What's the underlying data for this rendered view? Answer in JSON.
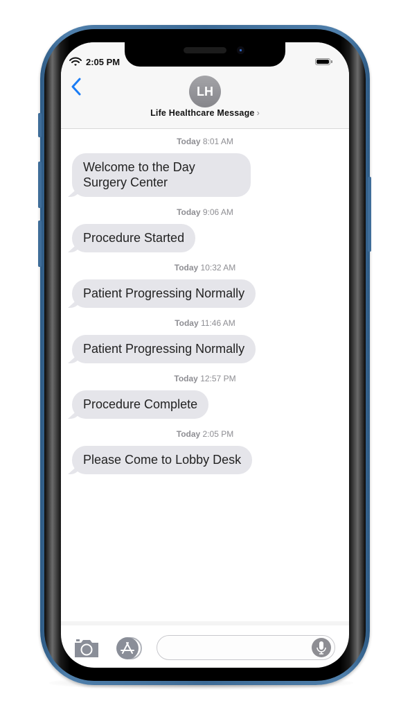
{
  "status_bar": {
    "time": "2:05 PM",
    "icons": [
      "wifi-icon",
      "battery-icon"
    ]
  },
  "header": {
    "back_icon": "chevron-left-icon",
    "avatar_initials": "LH",
    "contact_name": "Life Healthcare Message",
    "contact_chevron": "›"
  },
  "messages": [
    {
      "day": "Today",
      "time": "8:01 AM",
      "text": "Welcome to the Day Surgery Center"
    },
    {
      "day": "Today",
      "time": "9:06 AM",
      "text": "Procedure Started"
    },
    {
      "day": "Today",
      "time": "10:32 AM",
      "text": "Patient Progressing Normally"
    },
    {
      "day": "Today",
      "time": "11:46 AM",
      "text": "Patient Progressing Normally"
    },
    {
      "day": "Today",
      "time": "12:57 PM",
      "text": "Procedure Complete"
    },
    {
      "day": "Today",
      "time": "2:05 PM",
      "text": "Please Come to Lobby Desk"
    }
  ],
  "composer": {
    "camera_icon": "camera-icon",
    "apps_icon": "app-store-icon",
    "input_value": "",
    "mic_icon": "microphone-icon"
  },
  "colors": {
    "accent": "#1a7cf5",
    "bubble": "#e5e5ea",
    "frame": "#3d6b96"
  }
}
